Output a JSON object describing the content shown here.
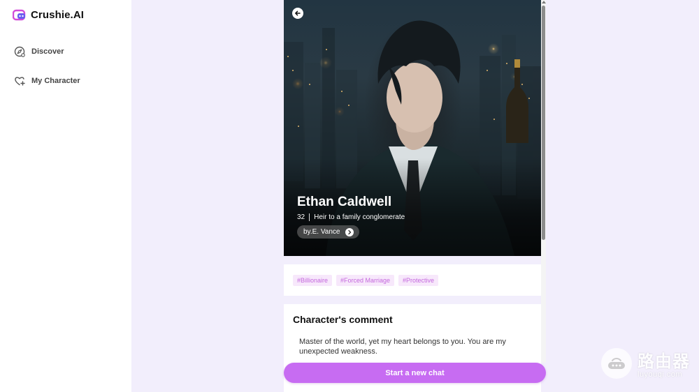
{
  "brand": {
    "name": "Crushie.AI",
    "accent": "#c76cf2"
  },
  "sidebar": {
    "items": [
      {
        "label": "Discover",
        "icon": "compass-icon"
      },
      {
        "label": "My Character",
        "icon": "heart-plus-icon"
      }
    ]
  },
  "character": {
    "name": "Ethan Caldwell",
    "age": "32",
    "role": "Heir to a family conglomerate",
    "author": "by.E. Vance"
  },
  "tags": [
    "#Billionaire",
    "#Forced Marriage",
    "#Protective"
  ],
  "comment": {
    "title": "Character's comment",
    "text": "Master of the world, yet my heart belongs to you. You are my unexpected weakness."
  },
  "actions": {
    "start_chat": "Start a new chat"
  },
  "watermark": {
    "main": "路由器",
    "sub": "luyouqi.com"
  }
}
